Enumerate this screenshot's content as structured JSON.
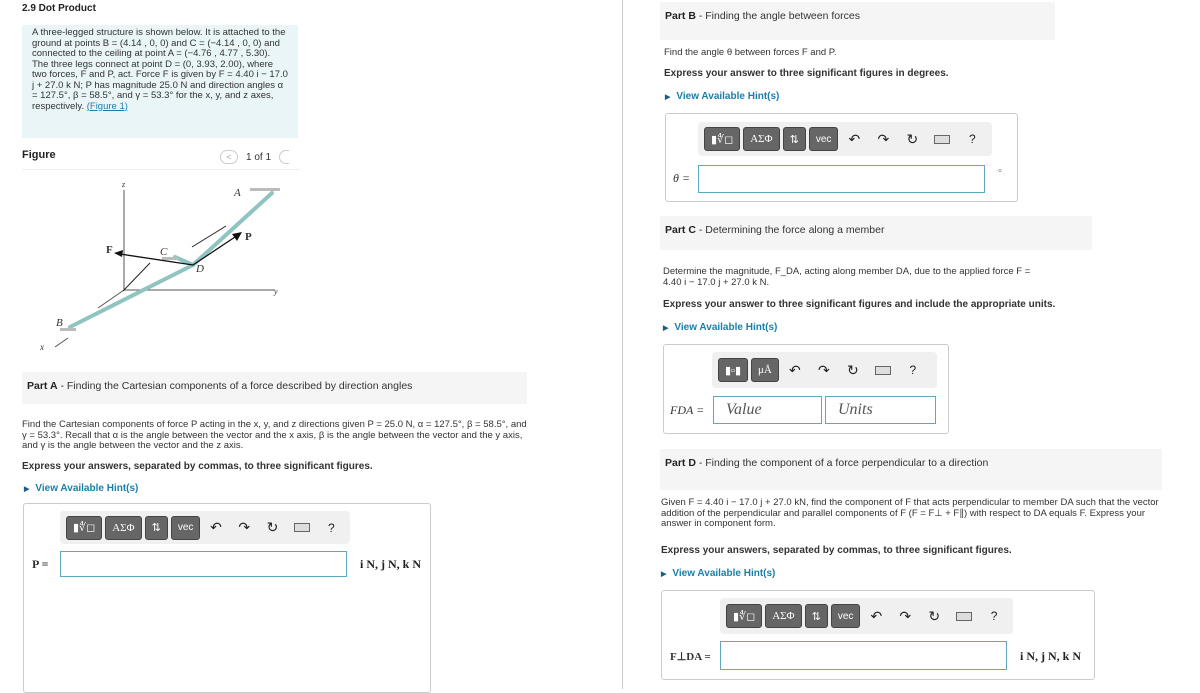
{
  "title": "2.9 Dot Product",
  "problem": {
    "text": "A three-legged structure is shown below. It is attached to the ground at points B = (4.14 , 0, 0) and C = (−4.14 , 0, 0) and connected to the ceiling at point A = (−4.76 , 4.77 , 5.30). The three legs connect at point D = (0, 3.93, 2.00), where two forces, F and P, act. Force F is given by F = 4.40 i − 17.0 j + 27.0 k N; P has magnitude 25.0 N and direction angles α = 127.5°, β = 58.5°, and γ = 53.3° for the x, y, and z axes, respectively.",
    "link": "(Figure 1)"
  },
  "figure": {
    "heading": "Figure",
    "pager": "1 of 1",
    "prev": "<",
    "labels": {
      "z": "z",
      "y": "y",
      "x": "x",
      "A": "A",
      "B": "B",
      "C": "C",
      "D": "D",
      "F": "F",
      "P": "P"
    }
  },
  "toolbar": {
    "templates": "▮∜◻",
    "greek": "ΑΣΦ",
    "arrows": "⇅",
    "vec": "vec",
    "undo": "↶",
    "redo": "↷",
    "reset": "↻",
    "help": "?",
    "units_tpl": "▮▫▮",
    "mu": "μÅ"
  },
  "hint": "View Available Hint(s)",
  "partA": {
    "label": "Part A",
    "title": " - Finding the Cartesian components  of a force described by direction angles",
    "text": "Find the Cartesian components of force P acting in the x, y, and z directions given P = 25.0 N, α = 127.5°, β = 58.5°, and γ = 53.3°. Recall that α is the angle between the vector and the x axis, β is the angle between the vector and the y axis, and γ is the angle between the vector and the z axis.",
    "express": "Express your answers, separated by commas, to three significant figures.",
    "var": "P =",
    "value": "",
    "units": "i N, j N, k N"
  },
  "partB": {
    "label": "Part B",
    "title": " - Finding the angle between forces",
    "text": "Find the angle θ between forces F and P.",
    "express": "Express your answer to three significant figures in degrees.",
    "var": "θ =",
    "value": "",
    "units": "°"
  },
  "partC": {
    "label": "Part C",
    "title": " - Determining the force along a member",
    "text": "Determine the magnitude, F_DA, acting along member DA, due to the applied force F = 4.40 i − 17.0 j + 27.0 k N.",
    "express": "Express your answer to three significant figures and include the appropriate units.",
    "var": "FDA =",
    "value_placeholder": "Value",
    "units_placeholder": "Units"
  },
  "partD": {
    "label": "Part D",
    "title": " - Finding the component of a force perpendicular to a direction",
    "text": "Given F = 4.40 i − 17.0 j + 27.0 kN, find the component of F that acts perpendicular to member DA such that the vector addition of the perpendicular and parallel components of F (F = F⊥ + F∥) with respect to DA equals F. Express your answer in component form.",
    "express": "Express your answers, separated by commas, to three significant figures.",
    "var": "F⊥DA =",
    "value": "",
    "units": "i N, j N, k N"
  }
}
